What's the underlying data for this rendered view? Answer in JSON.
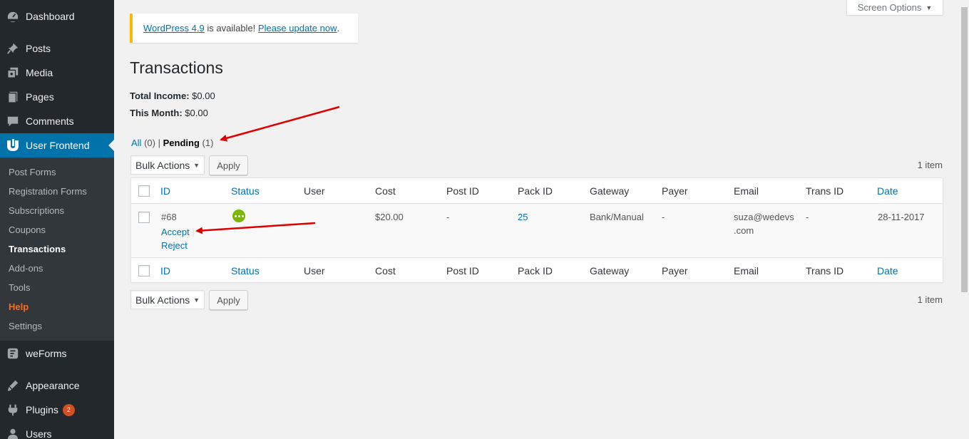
{
  "sidebar": {
    "top_items": [
      {
        "label": "Dashboard",
        "icon": "dashboard-icon"
      },
      {
        "label": "Posts",
        "icon": "pin-icon"
      },
      {
        "label": "Media",
        "icon": "media-icon"
      },
      {
        "label": "Pages",
        "icon": "page-icon"
      },
      {
        "label": "Comments",
        "icon": "comment-icon"
      },
      {
        "label": "User Frontend",
        "icon": "user-frontend-icon"
      }
    ],
    "submenu": [
      "Post Forms",
      "Registration Forms",
      "Subscriptions",
      "Coupons",
      "Transactions",
      "Add-ons",
      "Tools",
      "Help",
      "Settings"
    ],
    "bottom_items": [
      {
        "label": "weForms",
        "icon": "weforms-icon"
      },
      {
        "label": "Appearance",
        "icon": "brush-icon"
      },
      {
        "label": "Plugins",
        "icon": "plug-icon",
        "badge": "2"
      },
      {
        "label": "Users",
        "icon": "users-icon"
      }
    ],
    "accent": "#0073aa"
  },
  "screen_options": {
    "label": "Screen Options"
  },
  "notice": {
    "link1": "WordPress 4.9",
    "text": " is available! ",
    "link2": "Please update now",
    "tail": "."
  },
  "page": {
    "title": "Transactions",
    "total_income_label": "Total Income:",
    "total_income_value": " $0.00",
    "this_month_label": "This Month:",
    "this_month_value": " $0.00"
  },
  "filters": {
    "all_label": "All",
    "all_count": "(0)",
    "separator": "|",
    "pending_label": "Pending",
    "pending_count": "(1)"
  },
  "bulk": {
    "select_label": "Bulk Actions",
    "apply_label": "Apply",
    "items_count": "1 item"
  },
  "table": {
    "headers": [
      "ID",
      "Status",
      "User",
      "Cost",
      "Post ID",
      "Pack ID",
      "Gateway",
      "Payer",
      "Email",
      "Trans ID",
      "Date"
    ],
    "row": {
      "id": "#68",
      "accept": "Accept",
      "row_sep": "|",
      "reject": "Reject",
      "user": "",
      "cost": "$20.00",
      "post_id": "-",
      "pack_id": "25",
      "gateway": "Bank/Manual",
      "payer": "-",
      "email_line1": "suza@wedevs",
      "email_line2": ".com",
      "trans_id": "-",
      "date": "28-11-2017",
      "status_color": "#7ab800"
    }
  },
  "annotation_color": "#e00000"
}
